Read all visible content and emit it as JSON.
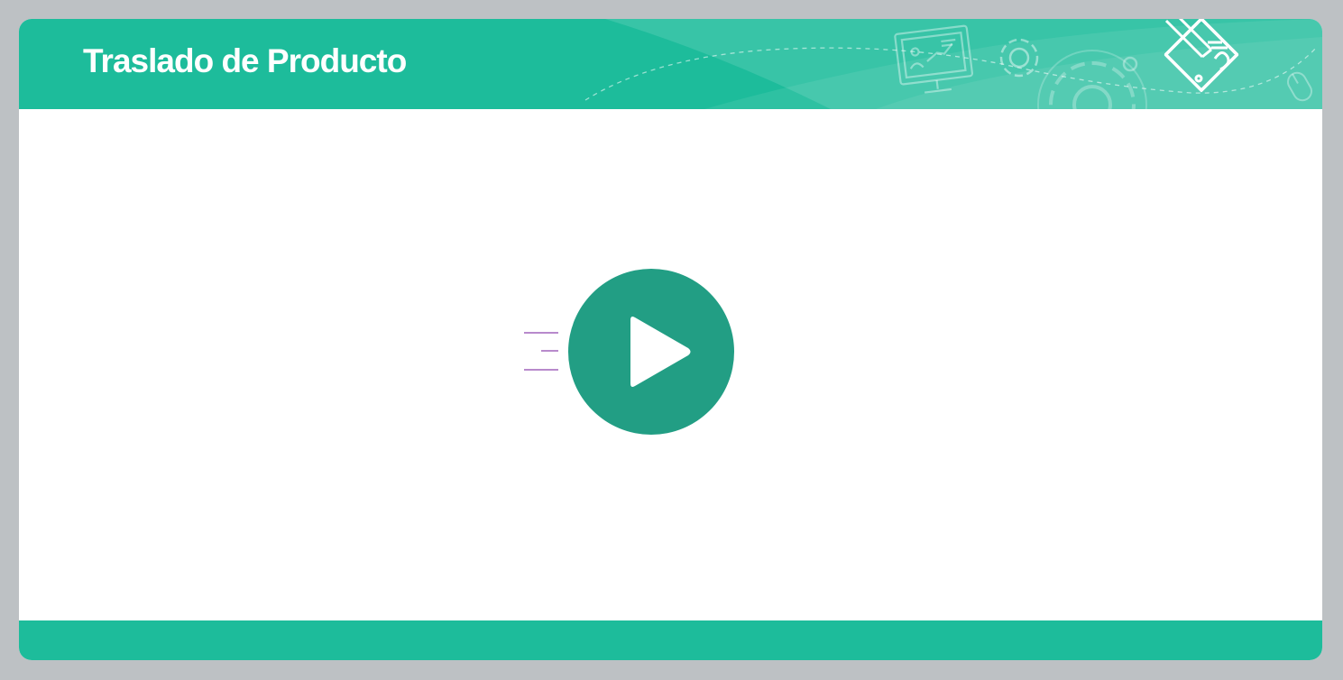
{
  "header": {
    "title": "Traslado de Producto",
    "background_color": "#1dbc9b",
    "decorations": [
      "presentation-screen-icon",
      "gear-icon",
      "large-gear-icon",
      "pencil-document-icon",
      "mouse-icon",
      "dashed-path"
    ]
  },
  "main": {
    "play_button": {
      "icon": "play-icon",
      "color": "#229e84"
    },
    "speed_lines_color": "#8e44ad"
  },
  "footer": {
    "background_color": "#1dbc9b"
  }
}
